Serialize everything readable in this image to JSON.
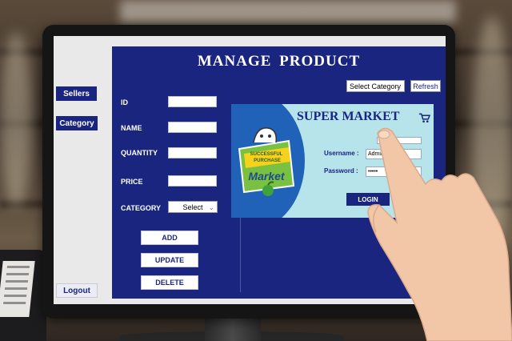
{
  "main": {
    "title": "MANAGE PRODUCT",
    "category_filter": "Select Category",
    "refresh_label": "Refresh",
    "form": {
      "id_label": "ID",
      "name_label": "NAME",
      "quantity_label": "QUANTITY",
      "price_label": "PRICE",
      "category_label": "CATEGORY",
      "category_value": "Select"
    },
    "actions": {
      "add": "ADD",
      "update": "UPDATE",
      "delete": "DELETE"
    }
  },
  "sidebar": {
    "sellers": "Sellers",
    "category": "Category",
    "logout": "Logout"
  },
  "login_card": {
    "title": "SUPER MARKET",
    "username_label": "Username :",
    "username_value": "Admin",
    "password_label": "Password :",
    "password_value": "•••••",
    "login_label": "LOGIN",
    "logo": {
      "ribbon_top": "SUCCESSFUL",
      "ribbon_bottom": "PURCHASE",
      "word": "Market"
    }
  },
  "colors": {
    "navy": "#1a2580",
    "card_bg": "#b7e4ea",
    "logo_green": "#7ac142"
  }
}
